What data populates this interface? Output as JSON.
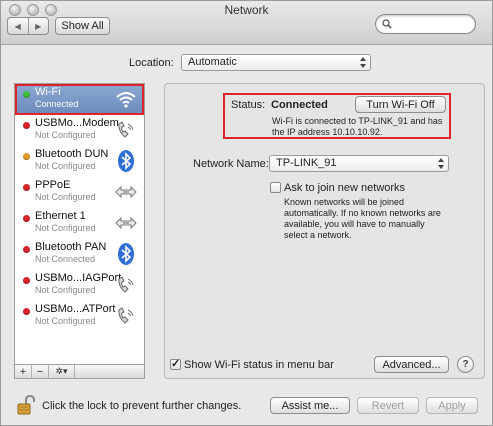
{
  "window": {
    "title": "Network"
  },
  "toolbar": {
    "back_glyph": "◀",
    "forward_glyph": "▶",
    "show_all_label": "Show All",
    "search": {
      "value": "",
      "placeholder": ""
    }
  },
  "location": {
    "label": "Location:",
    "value": "Automatic"
  },
  "sidebar": {
    "items": [
      {
        "name": "Wi-Fi",
        "status": "Connected",
        "dot_color": "#3fbf3a",
        "icon": "wifi-icon"
      },
      {
        "name": "USBMo...Modem",
        "status": "Not Configured",
        "dot_color": "#d8232a",
        "icon": "phone-icon"
      },
      {
        "name": "Bluetooth DUN",
        "status": "Not Configured",
        "dot_color": "#e39a2b",
        "icon": "bluetooth-icon"
      },
      {
        "name": "PPPoE",
        "status": "Not Configured",
        "dot_color": "#d8232a",
        "icon": "arrows-icon"
      },
      {
        "name": "Ethernet 1",
        "status": "Not Configured",
        "dot_color": "#d8232a",
        "icon": "arrows-icon"
      },
      {
        "name": "Bluetooth PAN",
        "status": "Not Connected",
        "dot_color": "#d8232a",
        "icon": "bluetooth-icon"
      },
      {
        "name": "USBMo...IAGPort",
        "status": "Not Configured",
        "dot_color": "#d8232a",
        "icon": "phone-icon"
      },
      {
        "name": "USBMo...ATPort",
        "status": "Not Configured",
        "dot_color": "#d8232a",
        "icon": "phone-icon"
      }
    ],
    "tools": {
      "add": "+",
      "remove": "−",
      "action": "✲▾"
    }
  },
  "status": {
    "label": "Status:",
    "value": "Connected",
    "button_label": "Turn Wi-Fi Off",
    "description": "Wi-Fi is connected to TP-LINK_91 and has the IP address 10.10.10.92."
  },
  "network_name": {
    "label": "Network Name:",
    "value": "TP-LINK_91"
  },
  "ask_join": {
    "label": "Ask to join new networks",
    "checked": false,
    "description": "Known networks will be joined automatically. If no known networks are available, you will have to manually select a network."
  },
  "show_status": {
    "label": "Show Wi-Fi status in menu bar",
    "checked": true
  },
  "advanced_label": "Advanced...",
  "help_label": "?",
  "footer": {
    "lock_text": "Click the lock to prevent further changes.",
    "assist_label": "Assist me...",
    "revert_label": "Revert",
    "apply_label": "Apply"
  },
  "colors": {
    "highlight_border": "#e0222a",
    "selected_row": "#7c99c6"
  }
}
